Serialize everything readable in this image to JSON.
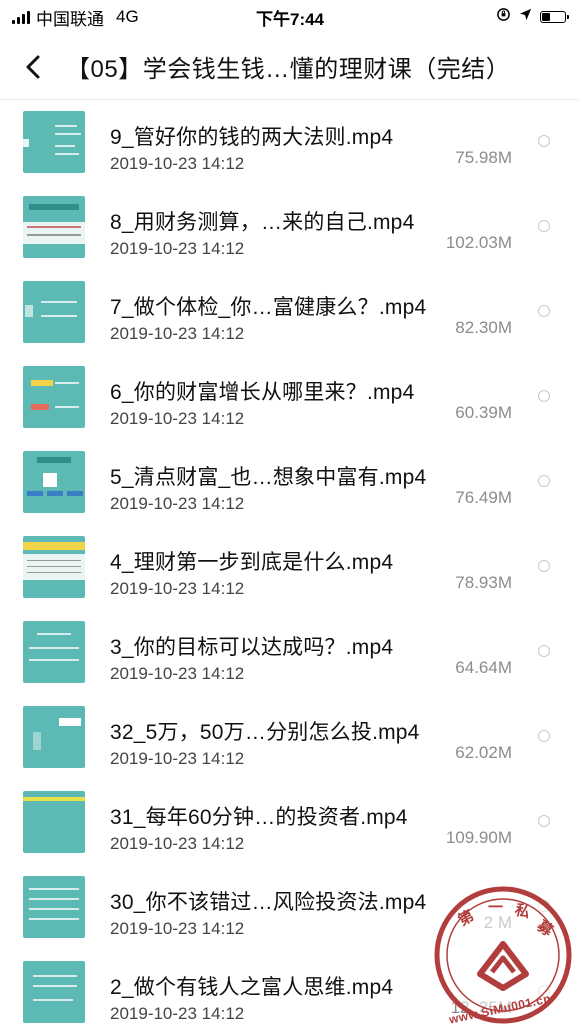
{
  "status_bar": {
    "carrier": "中国联通",
    "network": "4G",
    "time": "下午7:44"
  },
  "nav": {
    "title": "【05】学会钱生钱…懂的理财课（完结）"
  },
  "files": [
    {
      "name": "9_管好你的钱的两大法则.mp4",
      "date": "2019-10-23 14:12",
      "size": "75.98M"
    },
    {
      "name": "8_用财务测算，…来的自己.mp4",
      "date": "2019-10-23 14:12",
      "size": "102.03M"
    },
    {
      "name": "7_做个体检_你…富健康么？.mp4",
      "date": "2019-10-23 14:12",
      "size": "82.30M"
    },
    {
      "name": "6_你的财富增长从哪里来？.mp4",
      "date": "2019-10-23 14:12",
      "size": "60.39M"
    },
    {
      "name": "5_清点财富_也…想象中富有.mp4",
      "date": "2019-10-23 14:12",
      "size": "76.49M"
    },
    {
      "name": "4_理财第一步到底是什么.mp4",
      "date": "2019-10-23 14:12",
      "size": "78.93M"
    },
    {
      "name": "3_你的目标可以达成吗？.mp4",
      "date": "2019-10-23 14:12",
      "size": "64.64M"
    },
    {
      "name": "32_5万，50万…分别怎么投.mp4",
      "date": "2019-10-23 14:12",
      "size": "62.02M"
    },
    {
      "name": "31_每年60分钟…的投资者.mp4",
      "date": "2019-10-23 14:12",
      "size": "109.90M"
    },
    {
      "name": "30_你不该错过…风险投资法.mp4",
      "date": "2019-10-23 14:12",
      "size": "2 M"
    },
    {
      "name": "2_做个有钱人之富人思维.mp4",
      "date": "2019-10-23 14:12",
      "size": "12 .35M"
    }
  ],
  "watermark": {
    "text": "第一私募",
    "url": "www.SiMu001.cn"
  },
  "colors": {
    "thumb": "#5cb9b4",
    "radio": "#c9c9c9",
    "watermark": "#b23d3d"
  }
}
